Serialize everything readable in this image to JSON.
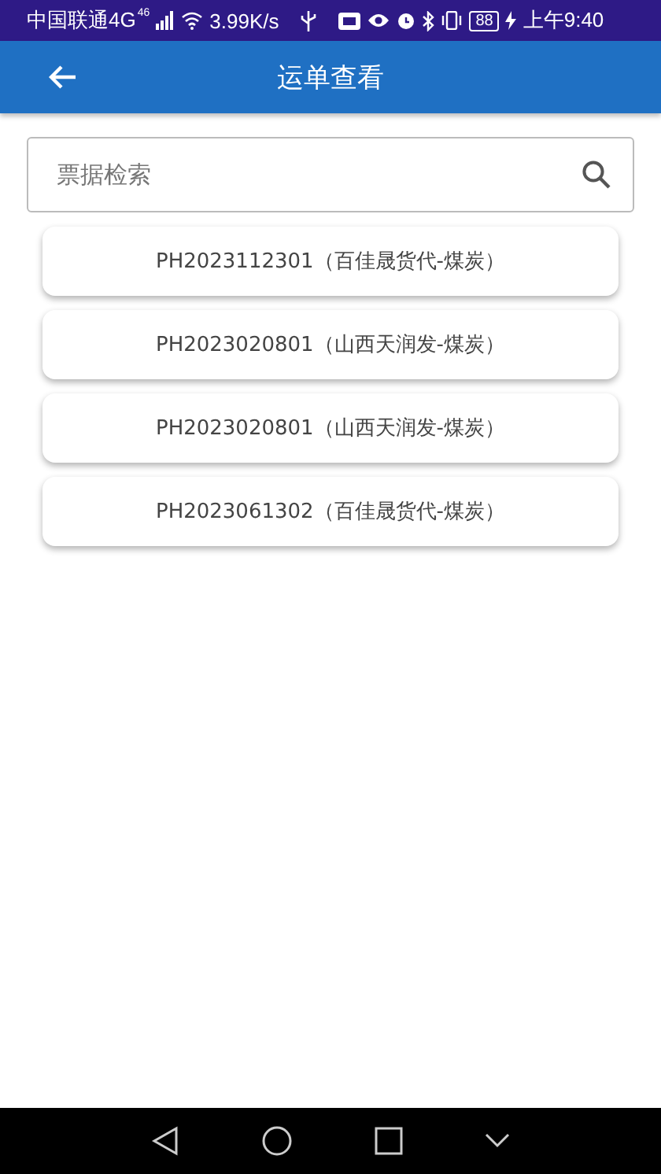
{
  "status_bar": {
    "carrier": "中国联通4G",
    "network": "46",
    "speed": "3.99K/s",
    "battery": "88",
    "time": "上午9:40"
  },
  "app_bar": {
    "title": "运单查看"
  },
  "search": {
    "placeholder": "票据检索"
  },
  "waybills": [
    {
      "label": "PH2023112301（百佳晟货代-煤炭）"
    },
    {
      "label": "PH2023020801（山西天润发-煤炭）"
    },
    {
      "label": "PH2023020801（山西天润发-煤炭）"
    },
    {
      "label": "PH2023061302（百佳晟货代-煤炭）"
    }
  ]
}
